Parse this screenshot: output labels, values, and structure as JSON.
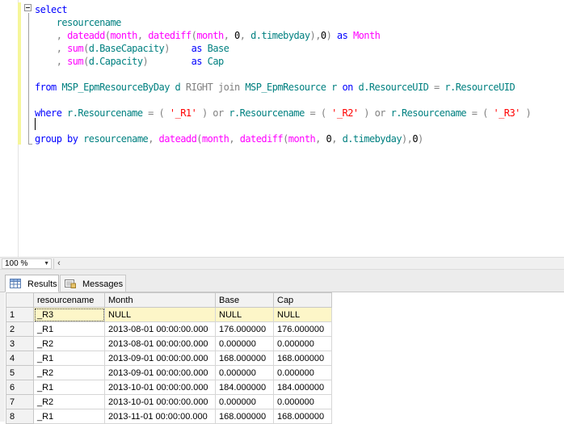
{
  "editor": {
    "lines": [
      {
        "tokens": [
          {
            "t": "select",
            "c": "kw"
          }
        ]
      },
      {
        "tokens": [
          {
            "t": "    resourcename",
            "c": "id"
          }
        ]
      },
      {
        "tokens": [
          {
            "t": "    , ",
            "c": "op"
          },
          {
            "t": "dateadd",
            "c": "fn"
          },
          {
            "t": "(",
            "c": "op"
          },
          {
            "t": "month",
            "c": "fn"
          },
          {
            "t": ", ",
            "c": "op"
          },
          {
            "t": "datediff",
            "c": "fn"
          },
          {
            "t": "(",
            "c": "op"
          },
          {
            "t": "month",
            "c": "fn"
          },
          {
            "t": ", ",
            "c": "op"
          },
          {
            "t": "0",
            "c": "nm"
          },
          {
            "t": ", ",
            "c": "op"
          },
          {
            "t": "d.timebyday",
            "c": "id"
          },
          {
            "t": "),",
            "c": "op"
          },
          {
            "t": "0",
            "c": "nm"
          },
          {
            "t": ") ",
            "c": "op"
          },
          {
            "t": "as",
            "c": "kw"
          },
          {
            "t": " Month",
            "c": "fn"
          }
        ]
      },
      {
        "tokens": [
          {
            "t": "    , ",
            "c": "op"
          },
          {
            "t": "sum",
            "c": "fn"
          },
          {
            "t": "(",
            "c": "op"
          },
          {
            "t": "d.BaseCapacity",
            "c": "id"
          },
          {
            "t": ")    ",
            "c": "op"
          },
          {
            "t": "as",
            "c": "kw"
          },
          {
            "t": " Base",
            "c": "id"
          }
        ]
      },
      {
        "tokens": [
          {
            "t": "    , ",
            "c": "op"
          },
          {
            "t": "sum",
            "c": "fn"
          },
          {
            "t": "(",
            "c": "op"
          },
          {
            "t": "d.Capacity",
            "c": "id"
          },
          {
            "t": ")        ",
            "c": "op"
          },
          {
            "t": "as",
            "c": "kw"
          },
          {
            "t": " Cap",
            "c": "id"
          }
        ]
      },
      {
        "tokens": []
      },
      {
        "tokens": [
          {
            "t": "from",
            "c": "kw"
          },
          {
            "t": " MSP_EpmResourceByDay d ",
            "c": "id"
          },
          {
            "t": "RIGHT",
            "c": "gr"
          },
          {
            "t": " ",
            "c": "nm"
          },
          {
            "t": "join",
            "c": "gr"
          },
          {
            "t": " MSP_EpmResource r ",
            "c": "id"
          },
          {
            "t": "on",
            "c": "kw"
          },
          {
            "t": " d.ResourceUID ",
            "c": "id"
          },
          {
            "t": "=",
            "c": "op"
          },
          {
            "t": " r.ResourceUID",
            "c": "id"
          }
        ]
      },
      {
        "tokens": []
      },
      {
        "tokens": [
          {
            "t": "where",
            "c": "kw"
          },
          {
            "t": " r.Resourcename ",
            "c": "id"
          },
          {
            "t": "=",
            "c": "op"
          },
          {
            "t": " ( ",
            "c": "op"
          },
          {
            "t": "'_R1'",
            "c": "str"
          },
          {
            "t": " ) ",
            "c": "op"
          },
          {
            "t": "or",
            "c": "gr"
          },
          {
            "t": " r.Resourcename ",
            "c": "id"
          },
          {
            "t": "=",
            "c": "op"
          },
          {
            "t": " ( ",
            "c": "op"
          },
          {
            "t": "'_R2'",
            "c": "str"
          },
          {
            "t": " ) ",
            "c": "op"
          },
          {
            "t": "or",
            "c": "gr"
          },
          {
            "t": " r.Resourcename ",
            "c": "id"
          },
          {
            "t": "=",
            "c": "op"
          },
          {
            "t": " ( ",
            "c": "op"
          },
          {
            "t": "'_R3'",
            "c": "str"
          },
          {
            "t": " )",
            "c": "op"
          }
        ]
      },
      {
        "tokens": []
      },
      {
        "tokens": [
          {
            "t": "group by",
            "c": "kw"
          },
          {
            "t": " resourcename",
            "c": "id"
          },
          {
            "t": ", ",
            "c": "op"
          },
          {
            "t": "dateadd",
            "c": "fn"
          },
          {
            "t": "(",
            "c": "op"
          },
          {
            "t": "month",
            "c": "fn"
          },
          {
            "t": ", ",
            "c": "op"
          },
          {
            "t": "datediff",
            "c": "fn"
          },
          {
            "t": "(",
            "c": "op"
          },
          {
            "t": "month",
            "c": "fn"
          },
          {
            "t": ", ",
            "c": "op"
          },
          {
            "t": "0",
            "c": "nm"
          },
          {
            "t": ", ",
            "c": "op"
          },
          {
            "t": "d.timebyday",
            "c": "id"
          },
          {
            "t": "),",
            "c": "op"
          },
          {
            "t": "0",
            "c": "nm"
          },
          {
            "t": ")",
            "c": "op"
          }
        ]
      }
    ]
  },
  "zoom": {
    "value": "100 %"
  },
  "tabs": {
    "results": "Results",
    "messages": "Messages"
  },
  "grid": {
    "columns": [
      "resourcename",
      "Month",
      "Base",
      "Cap"
    ],
    "rows": [
      [
        "1",
        "_R3",
        "NULL",
        "NULL",
        "NULL"
      ],
      [
        "2",
        "_R1",
        "2013-08-01 00:00:00.000",
        "176.000000",
        "176.000000"
      ],
      [
        "3",
        "_R2",
        "2013-08-01 00:00:00.000",
        "0.000000",
        "0.000000"
      ],
      [
        "4",
        "_R1",
        "2013-09-01 00:00:00.000",
        "168.000000",
        "168.000000"
      ],
      [
        "5",
        "_R2",
        "2013-09-01 00:00:00.000",
        "0.000000",
        "0.000000"
      ],
      [
        "6",
        "_R1",
        "2013-10-01 00:00:00.000",
        "184.000000",
        "184.000000"
      ],
      [
        "7",
        "_R2",
        "2013-10-01 00:00:00.000",
        "0.000000",
        "0.000000"
      ],
      [
        "8",
        "_R1",
        "2013-11-01 00:00:00.000",
        "168.000000",
        "168.000000"
      ]
    ]
  },
  "colors": {
    "keyword": "#0000ff",
    "function": "#ff00ff",
    "identifier": "#008080",
    "string": "#ff0000",
    "operator": "#808080",
    "selected_row": "#fdf6c8"
  },
  "icons": {
    "results_tab": "grid-icon",
    "messages_tab": "messages-icon"
  }
}
